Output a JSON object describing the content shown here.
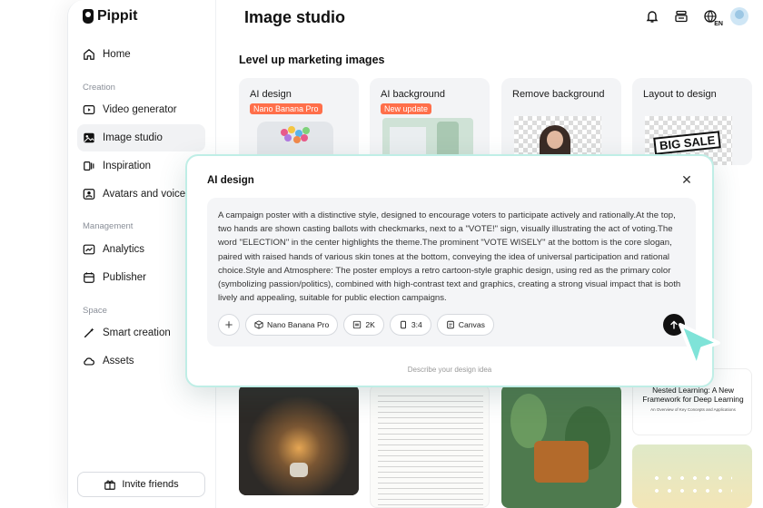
{
  "brand": {
    "name": "Pippit"
  },
  "header": {
    "title": "Image studio",
    "lang_badge": "EN"
  },
  "sidebar": {
    "items": [
      {
        "label": "Home",
        "icon": "home-icon"
      },
      {
        "label": "Video generator",
        "icon": "video-generator-icon"
      },
      {
        "label": "Image studio",
        "icon": "image-studio-icon"
      },
      {
        "label": "Inspiration",
        "icon": "inspiration-icon"
      },
      {
        "label": "Avatars and voices",
        "icon": "avatar-icon"
      },
      {
        "label": "Analytics",
        "icon": "analytics-icon"
      },
      {
        "label": "Publisher",
        "icon": "calendar-icon"
      },
      {
        "label": "Smart creation",
        "icon": "magic-wand-icon"
      },
      {
        "label": "Assets",
        "icon": "cloud-icon"
      }
    ],
    "sections": {
      "creation": "Creation",
      "management": "Management",
      "space": "Space"
    },
    "invite_label": "Invite friends"
  },
  "main": {
    "section_title": "Level up marketing images",
    "cards": [
      {
        "label": "AI design",
        "badge": "Nano Banana Pro"
      },
      {
        "label": "AI background",
        "badge": "New update"
      },
      {
        "label": "Remove background",
        "badge": ""
      },
      {
        "label": "Layout to design",
        "badge": "",
        "sale_text": "BIG SALE"
      }
    ],
    "gallery": {
      "paper_title": "Nested Learning: A New Framework for Deep Learning",
      "paper_subtitle": "An Overview of Key Concepts and Applications"
    }
  },
  "modal": {
    "title": "AI design",
    "prompt": "A campaign poster with a distinctive style, designed to encourage voters to participate actively and rationally.At the top, two hands are shown casting ballots with checkmarks, next to a \"VOTE!\" sign, visually illustrating the act of voting.The word \"ELECTION\" in the center highlights the theme.The prominent \"VOTE WISELY\" at the bottom is the core slogan, paired with raised hands of various skin tones at the bottom, conveying the idea of universal participation and rational choice.Style and Atmosphere: The poster employs a retro cartoon-style graphic design, using red as the primary color (symbolizing passion/politics), combined with high-contrast text and graphics, creating a strong visual impact that is both lively and appealing, suitable for public election campaigns.",
    "model_label": "Nano Banana Pro",
    "resolution_label": "2K",
    "ratio_label": "3:4",
    "canvas_label": "Canvas",
    "hint": "Describe your design idea"
  },
  "colors": {
    "accent_badge": "#ff6f4a",
    "modal_border": "#bfeee6",
    "cursor": "#7fe3d8"
  }
}
